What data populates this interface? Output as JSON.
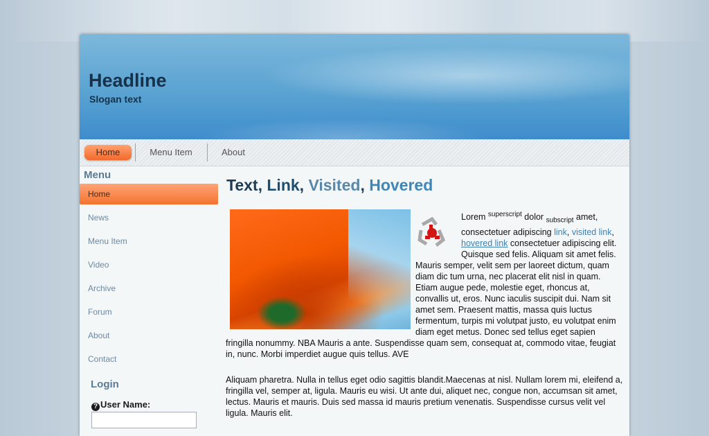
{
  "header": {
    "headline": "Headline",
    "slogan": "Slogan text"
  },
  "nav": [
    {
      "label": "Home",
      "active": true
    },
    {
      "label": "Menu Item"
    },
    {
      "label": "About"
    }
  ],
  "sidebar": {
    "title": "Menu",
    "items": [
      {
        "label": "Home",
        "active": true
      },
      {
        "label": "News"
      },
      {
        "label": "Menu Item"
      },
      {
        "label": "Video"
      },
      {
        "label": "Archive"
      },
      {
        "label": "Forum"
      },
      {
        "label": "About"
      },
      {
        "label": "Contact"
      }
    ]
  },
  "login": {
    "title": "Login",
    "username_label": "User Name:",
    "username_value": ""
  },
  "content": {
    "title_text": "Text",
    "sep1": ", ",
    "title_link": "Link",
    "sep2": ", ",
    "title_visited": "Visited",
    "sep3": ", ",
    "title_hovered": "Hovered",
    "p1_a": "Lorem ",
    "p1_sup": "superscript",
    "p1_b": " dolor ",
    "p1_sub": "subscript",
    "p1_c": " amet, consectetuer adipiscing ",
    "p1_link": "link",
    "p1_d": ", ",
    "p1_visited": "visited link",
    "p1_e": ", ",
    "p1_hovered": "hovered link",
    "p1_f": " consectetuer adipiscing elit. Quisque sed felis. Aliquam sit amet felis. Mauris semper, velit sem per laoreet dictum, quam diam dic tum urna, nec placerat elit nisl in quam. Etiam augue pede, molestie eget, rhoncus at, convallis ut, eros. Nunc iaculis suscipit dui. Nam sit amet sem. Praesent mattis, massa quis luctus fermentum, turpis mi volutpat justo, eu volutpat enim diam eget metus. Donec sed tellus eget sapien fringilla nonummy. NBA Mauris a ante. Suspendisse quam sem, consequat at, commodo vitae, feugiat in, nunc. Morbi imperdiet augue quis tellus. AVE",
    "p2": "Aliquam pharetra. Nulla in tellus eget odio sagittis blandit.Maecenas at nisl. Nullam lorem mi, eleifend a, fringilla vel, semper at, ligula. Mauris eu wisi. Ut ante dui, aliquet nec, congue non, accumsan sit amet, lectus. Mauris et mauris. Duis sed massa id mauris pretium venenatis. Suspendisse cursus velit vel ligula. Mauris elit."
  },
  "colors": {
    "accent": "#f3692c",
    "header_blue": "#5aa3d2",
    "title_dark": "#1f3d55"
  },
  "icons": {
    "help": "question-circle-icon",
    "logo": "chain-link-icon"
  }
}
